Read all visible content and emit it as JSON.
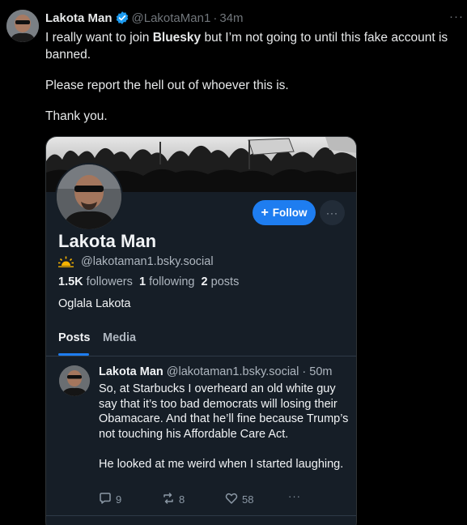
{
  "tweet": {
    "author_name": "Lakota Man",
    "handle": "@LakotaMan1",
    "separator": "·",
    "time": "34m",
    "more_label": "···",
    "text_before_bold": "I really want to join ",
    "text_bold": "Bluesky",
    "text_after_bold": " but I’m not going to until this fake account is banned.",
    "paragraph2": "Please report the hell out of whoever this is.",
    "paragraph3": "Thank you."
  },
  "embed": {
    "follow_label": "Follow",
    "follow_plus": "+",
    "more_label": "···",
    "display_name": "Lakota Man",
    "handle": "@lakotaman1.bsky.social",
    "followers_count": "1.5K",
    "followers_label": "followers",
    "following_count": "1",
    "following_label": "following",
    "posts_count": "2",
    "posts_label": "posts",
    "bio": "Oglala Lakota",
    "tabs": [
      {
        "label": "Posts",
        "active": true
      },
      {
        "label": "Media",
        "active": false
      }
    ],
    "post": {
      "author_name": "Lakota Man",
      "handle": "@lakotaman1.bsky.social",
      "separator": "·",
      "time": "50m",
      "paragraph1": "So, at Starbucks I overheard an old white guy say that it’s too bad democrats will losing their Obamacare. And that he’ll fine because Trump’s not touching his Affordable Care Act.",
      "paragraph2": "He looked at me weird when I started laughing.",
      "reply_count": "9",
      "repost_count": "8",
      "like_count": "58",
      "more_label": "···"
    }
  },
  "colors": {
    "background": "#000000",
    "card_background": "#161e27",
    "accent_blue": "#1e7df0",
    "muted_text": "#71767b",
    "verified_blue": "#1d9bf0"
  },
  "icons": {
    "verified": "verified-badge-icon",
    "sun": "sunrise-icon",
    "reply": "speech-bubble-icon",
    "repost": "repost-arrows-icon",
    "like": "heart-icon"
  }
}
